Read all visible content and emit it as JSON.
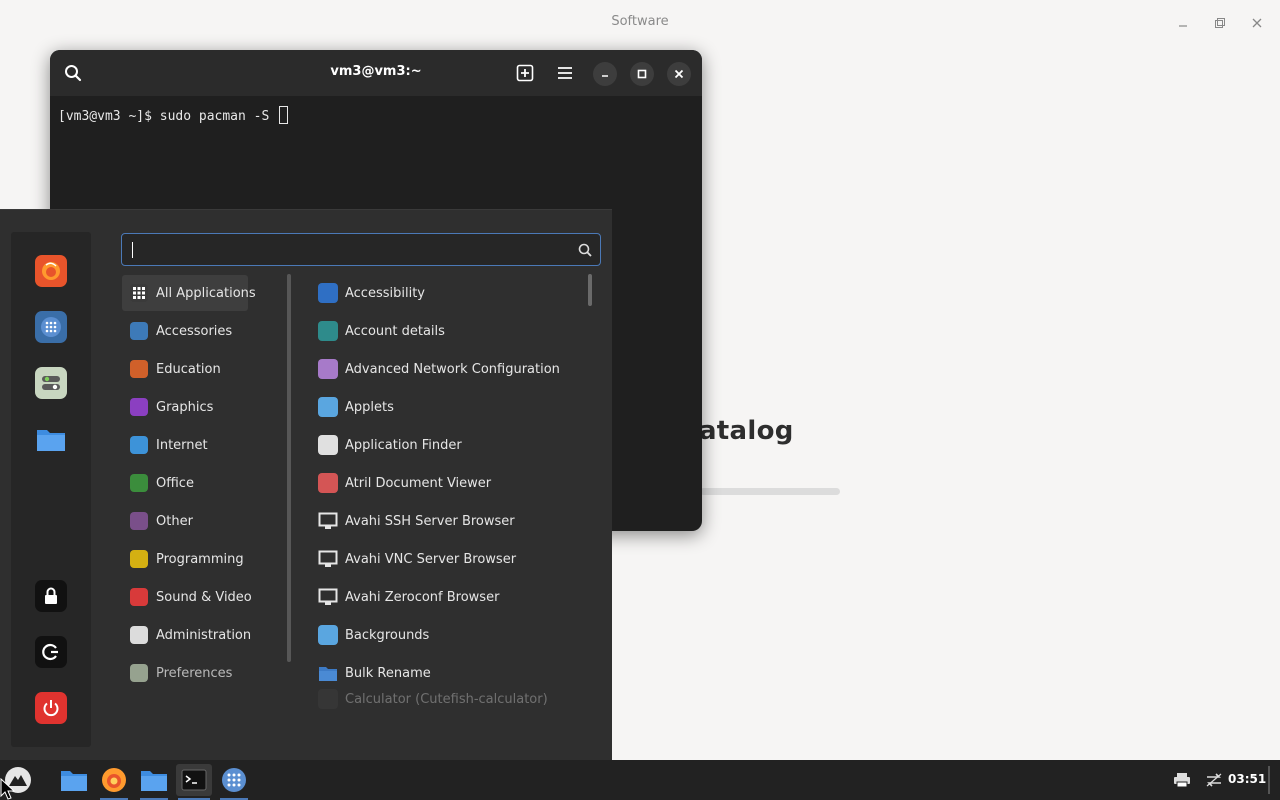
{
  "software": {
    "title": "Software",
    "catalog_text": "are catalog"
  },
  "terminal": {
    "title": "vm3@vm3:~",
    "prompt": "[vm3@vm3 ~]$ sudo pacman -S "
  },
  "menu": {
    "search_value": "",
    "categories": [
      {
        "label": "All Applications",
        "icon": "grid-icon",
        "color": "#3a3a3a"
      },
      {
        "label": "Accessories",
        "icon": "scissors-icon",
        "color": "#3d7ab8"
      },
      {
        "label": "Education",
        "icon": "education-icon",
        "color": "#d0602a"
      },
      {
        "label": "Graphics",
        "icon": "graphics-icon",
        "color": "#8b3fc1"
      },
      {
        "label": "Internet",
        "icon": "cloud-icon",
        "color": "#3d93d9"
      },
      {
        "label": "Office",
        "icon": "office-icon",
        "color": "#3b8d3c"
      },
      {
        "label": "Other",
        "icon": "other-icon",
        "color": "#7a4f8a"
      },
      {
        "label": "Programming",
        "icon": "programming-icon",
        "color": "#d4b012"
      },
      {
        "label": "Sound & Video",
        "icon": "play-icon",
        "color": "#d83a3a"
      },
      {
        "label": "Administration",
        "icon": "administration-icon",
        "color": "#dcdcdc"
      },
      {
        "label": "Preferences",
        "icon": "preferences-icon",
        "color": "#b9c9b0"
      }
    ],
    "apps": [
      {
        "label": "Accessibility",
        "icon": "accessibility-icon",
        "color": "#2f6fc4"
      },
      {
        "label": "Account details",
        "icon": "account-icon",
        "color": "#2e8b8b"
      },
      {
        "label": "Advanced Network Configuration",
        "icon": "network-icon",
        "color": "#a77ac9"
      },
      {
        "label": "Applets",
        "icon": "applets-icon",
        "color": "#5aa6e0"
      },
      {
        "label": "Application Finder",
        "icon": "finder-icon",
        "color": "#e0e0e0"
      },
      {
        "label": "Atril Document Viewer",
        "icon": "atril-icon",
        "color": "#d45555"
      },
      {
        "label": "Avahi SSH Server Browser",
        "icon": "monitor-icon",
        "color": "#e6e6e6"
      },
      {
        "label": "Avahi VNC Server Browser",
        "icon": "monitor-icon",
        "color": "#e6e6e6"
      },
      {
        "label": "Avahi Zeroconf Browser",
        "icon": "monitor-icon",
        "color": "#e6e6e6"
      },
      {
        "label": "Backgrounds",
        "icon": "backgrounds-icon",
        "color": "#5aa6e0"
      },
      {
        "label": "Bulk Rename",
        "icon": "folder-icon",
        "color": "#4a8ad4"
      },
      {
        "label": "Calculator (Cutefish-calculator)",
        "icon": "calculator-icon",
        "color": "#444444"
      }
    ]
  },
  "taskbar": {
    "clock": "03:51"
  }
}
